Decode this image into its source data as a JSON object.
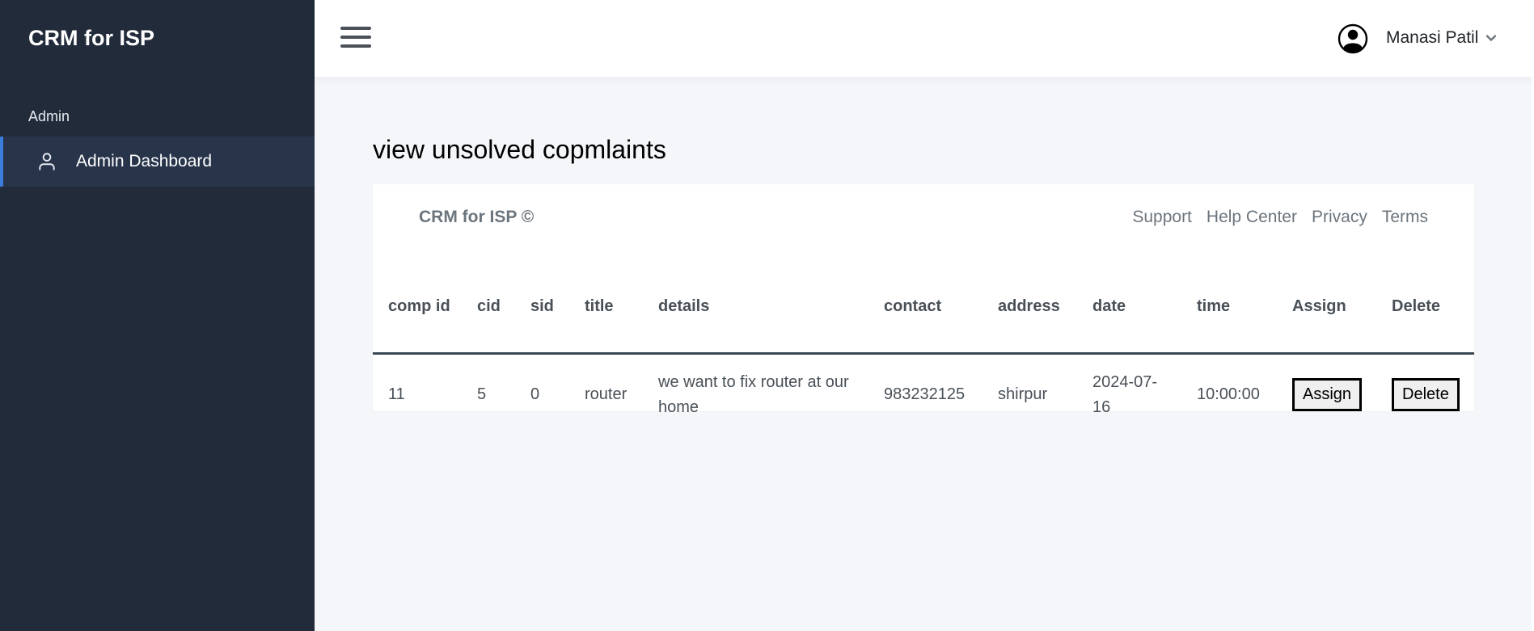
{
  "sidebar": {
    "brand": "CRM for ISP",
    "heading": "Admin",
    "items": [
      {
        "label": "Admin Dashboard",
        "icon": "user-icon"
      }
    ]
  },
  "topbar": {
    "menu_icon": "hamburger-icon",
    "user_icon": "user-circle-icon",
    "user_name": "Manasi Patil",
    "caret_icon": "chevron-down-icon"
  },
  "main": {
    "title": "view unsolved copmlaints",
    "card_brand": "CRM for ISP ©",
    "footer_links": [
      "Support",
      "Help Center",
      "Privacy",
      "Terms"
    ],
    "table": {
      "headers": [
        "comp id",
        "cid",
        "sid",
        "title",
        "details",
        "contact",
        "address",
        "date",
        "time",
        "Assign",
        "Delete"
      ],
      "rows": [
        {
          "comp_id": "11",
          "cid": "5",
          "sid": "0",
          "title": "router",
          "details": "we want to fix router at our home",
          "contact": "983232125",
          "address": "shirpur",
          "date": "2024-07-16",
          "time": "10:00:00",
          "assign_label": "Assign",
          "delete_label": "Delete"
        }
      ]
    }
  },
  "colors": {
    "sidebar_bg": "#212b3a",
    "sidebar_active_bg": "#27344a",
    "accent": "#3b7ddd",
    "page_bg": "#f4f6f9"
  }
}
